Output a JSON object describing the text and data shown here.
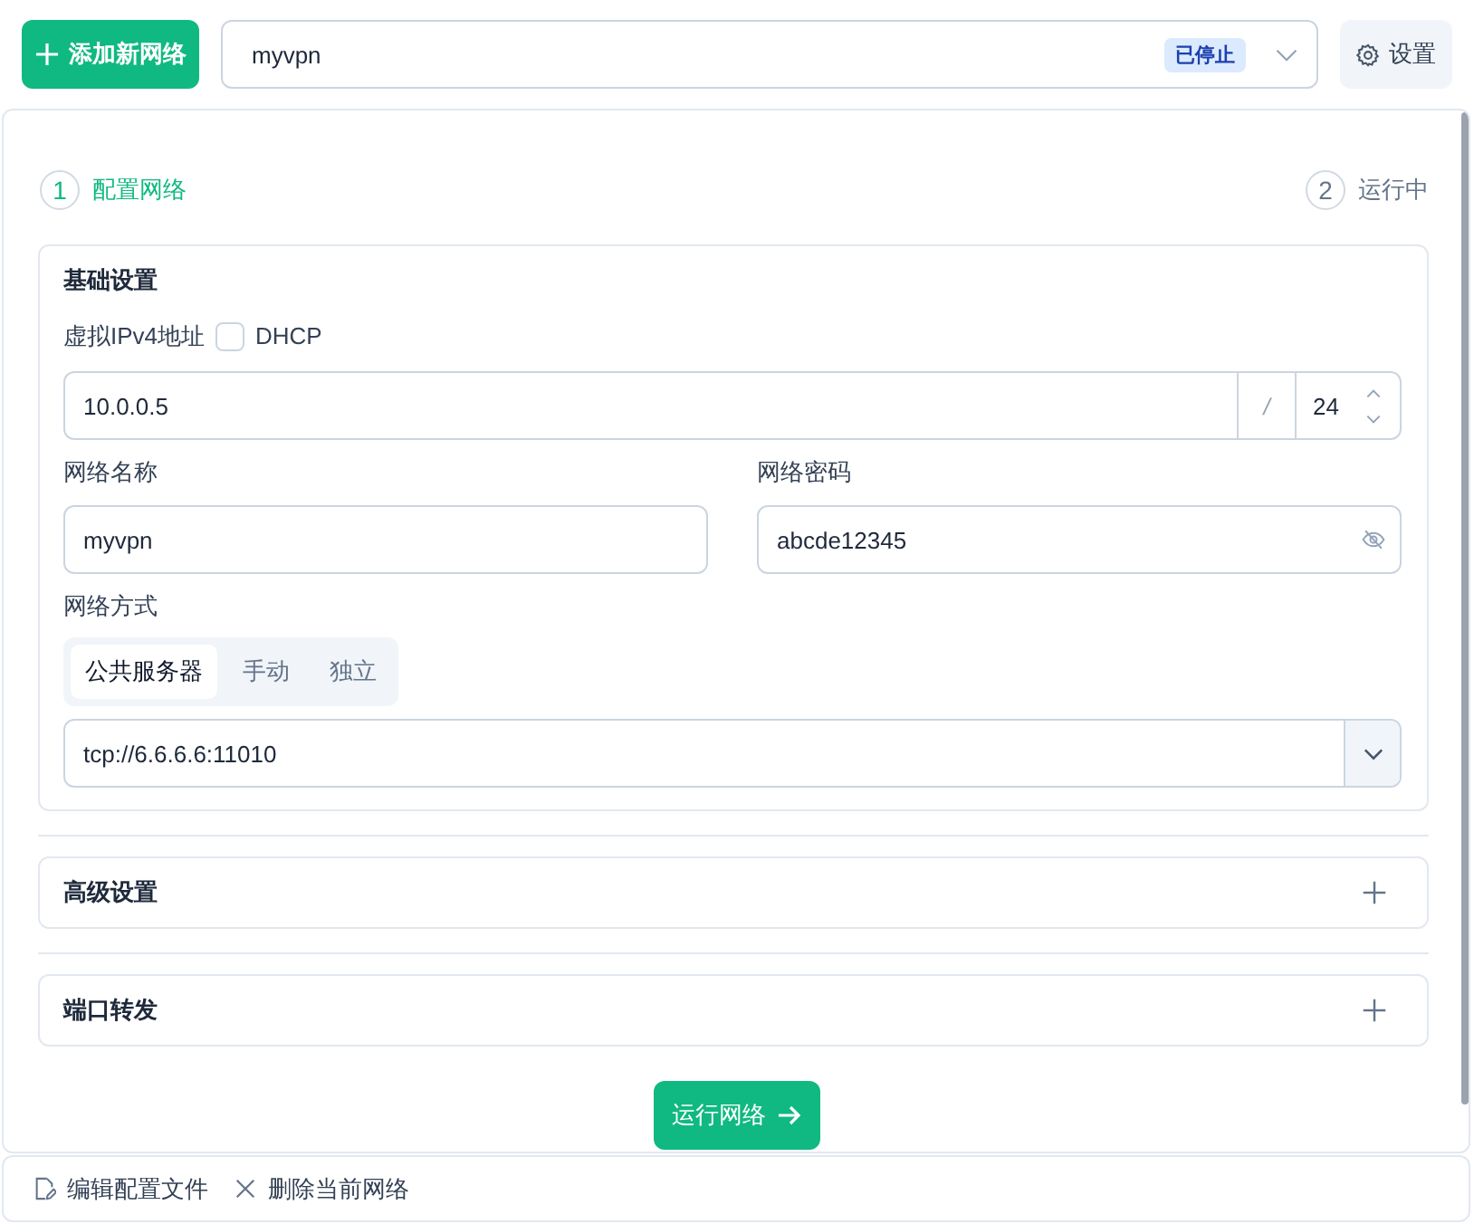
{
  "toolbar": {
    "add_button": "添加新网络",
    "network_select": {
      "value": "myvpn",
      "status": "已停止"
    },
    "settings_button": "设置"
  },
  "steps": [
    {
      "number": "1",
      "label": "配置网络",
      "selected": true
    },
    {
      "number": "2",
      "label": "运行中",
      "selected": false
    }
  ],
  "basic_settings": {
    "title": "基础设置",
    "ipv4": {
      "label": "虚拟IPv4地址",
      "dhcp": {
        "label": "DHCP",
        "checked": false
      },
      "address": "10.0.0.5",
      "separator": "/",
      "prefix": "24"
    },
    "network_name": {
      "label": "网络名称",
      "value": "myvpn"
    },
    "network_secret": {
      "label": "网络密码",
      "value": "abcde12345"
    },
    "network_mode": {
      "label": "网络方式",
      "options": [
        {
          "label": "公共服务器",
          "selected": true
        },
        {
          "label": "手动",
          "selected": false
        },
        {
          "label": "独立",
          "selected": false
        }
      ],
      "server": "tcp://6.6.6.6:11010"
    }
  },
  "sections": [
    {
      "title": "高级设置",
      "expanded": false
    },
    {
      "title": "端口转发",
      "expanded": false
    }
  ],
  "run_button": "运行网络",
  "footer_actions": [
    {
      "label": "编辑配置文件",
      "kind": "edit"
    },
    {
      "label": "删除当前网络",
      "kind": "delete"
    }
  ]
}
